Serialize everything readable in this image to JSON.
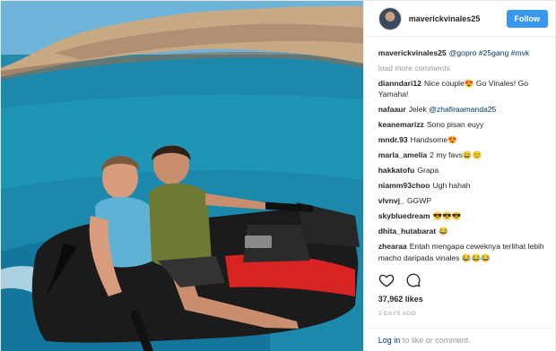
{
  "header": {
    "username": "maverickvinales25",
    "follow_label": "Follow"
  },
  "caption": {
    "user": "maverickvinales25",
    "text": "@gopro #25gang #mvk"
  },
  "load_more": "load more comments",
  "comments": [
    {
      "user": "dianndari12",
      "text": "Nice couple😍 Go Vinales! Go Yamaha!"
    },
    {
      "user": "nafaaur",
      "text": "Jelek @zhafiraamanda25"
    },
    {
      "user": "keanemarizz",
      "text": "Sono pisan euyy"
    },
    {
      "user": "mndr.93",
      "text": "Handsome😍"
    },
    {
      "user": "marla_amelia",
      "text": "2 my favs😄😊"
    },
    {
      "user": "hakkatofu",
      "text": "Grapa"
    },
    {
      "user": "niamm93choo",
      "text": "Ugh hahah"
    },
    {
      "user": "vlvnvj_",
      "text": "GGWP"
    },
    {
      "user": "skybluedream",
      "text": "😎😎😎"
    },
    {
      "user": "dhita_hutabarat",
      "text": "😂"
    },
    {
      "user": "zhearaa",
      "text": "Entah mengapa ceweknya terlihat lebih macho daripada vinales 😂😂😂"
    }
  ],
  "icons": {
    "like": "heart-icon",
    "comment": "comment-icon"
  },
  "likes": "37,962 likes",
  "timestamp": "2 DAYS AGO",
  "footer": {
    "login_link": "Log in",
    "rest": " to like or comment."
  },
  "colors": {
    "follow": "#3897f0",
    "link": "#003569",
    "muted": "#999999"
  }
}
